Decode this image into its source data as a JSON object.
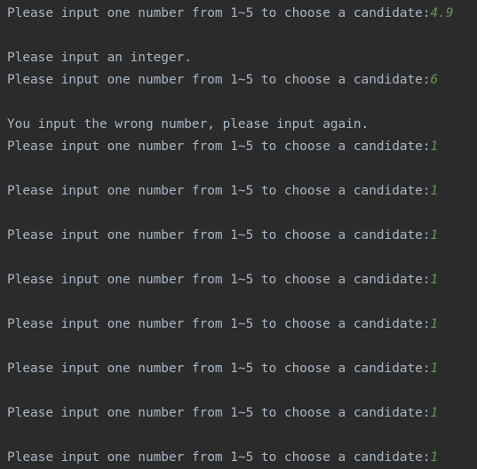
{
  "console": {
    "lines": [
      {
        "kind": "prompt",
        "text": "Please input one number from 1~5 to choose a candidate:",
        "input": "4.9"
      },
      {
        "kind": "blank",
        "text": ""
      },
      {
        "kind": "message",
        "text": "Please input an integer."
      },
      {
        "kind": "prompt",
        "text": "Please input one number from 1~5 to choose a candidate:",
        "input": "6"
      },
      {
        "kind": "blank",
        "text": ""
      },
      {
        "kind": "message",
        "text": "You input the wrong number, please input again."
      },
      {
        "kind": "prompt",
        "text": "Please input one number from 1~5 to choose a candidate:",
        "input": "1"
      },
      {
        "kind": "blank",
        "text": ""
      },
      {
        "kind": "prompt",
        "text": "Please input one number from 1~5 to choose a candidate:",
        "input": "1"
      },
      {
        "kind": "blank",
        "text": ""
      },
      {
        "kind": "prompt",
        "text": "Please input one number from 1~5 to choose a candidate:",
        "input": "1"
      },
      {
        "kind": "blank",
        "text": ""
      },
      {
        "kind": "prompt",
        "text": "Please input one number from 1~5 to choose a candidate:",
        "input": "1"
      },
      {
        "kind": "blank",
        "text": ""
      },
      {
        "kind": "prompt",
        "text": "Please input one number from 1~5 to choose a candidate:",
        "input": "1"
      },
      {
        "kind": "blank",
        "text": ""
      },
      {
        "kind": "prompt",
        "text": "Please input one number from 1~5 to choose a candidate:",
        "input": "1"
      },
      {
        "kind": "blank",
        "text": ""
      },
      {
        "kind": "prompt",
        "text": "Please input one number from 1~5 to choose a candidate:",
        "input": "1"
      },
      {
        "kind": "blank",
        "text": ""
      },
      {
        "kind": "prompt",
        "text": "Please input one number from 1~5 to choose a candidate:",
        "input": "1"
      }
    ]
  },
  "colors": {
    "background": "#2b2b2b",
    "output_text": "#a9b7c6",
    "user_input": "#629755"
  }
}
